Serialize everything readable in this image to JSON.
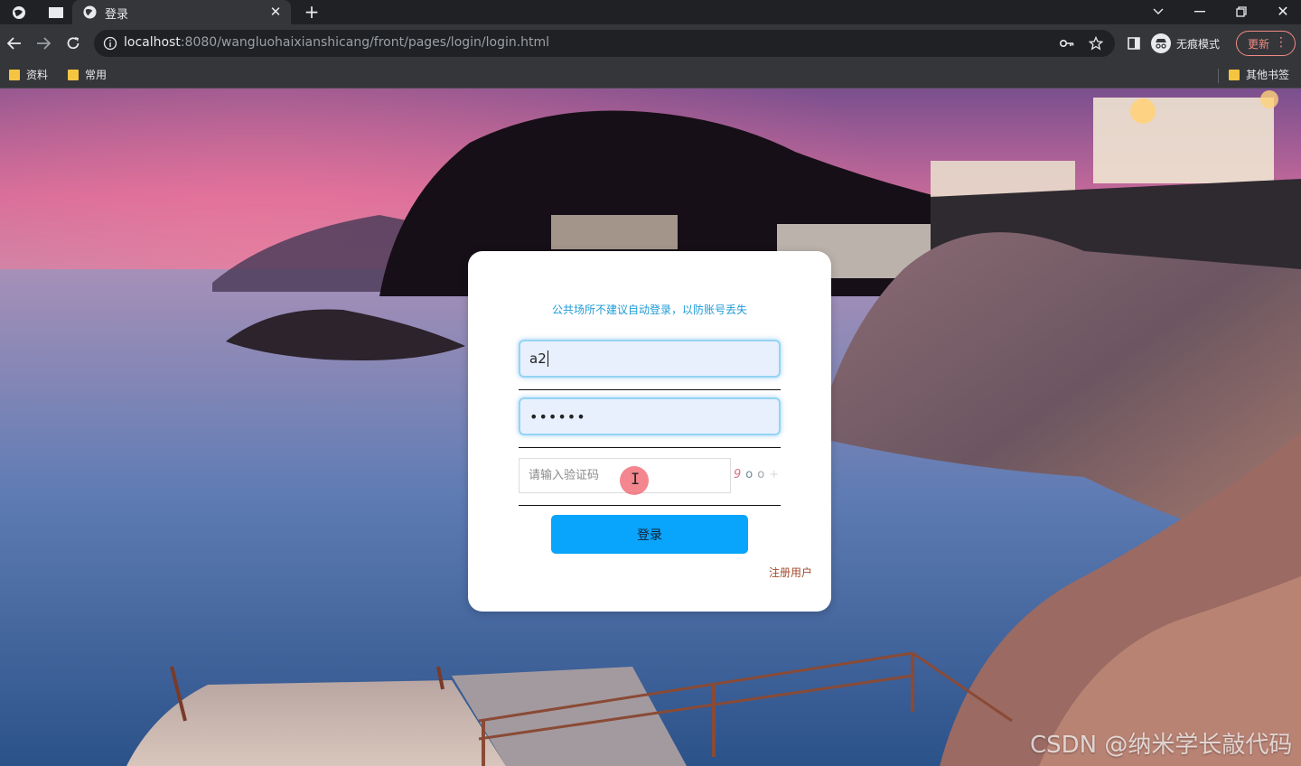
{
  "browser": {
    "tab_title": "登录",
    "url_host": "localhost",
    "url_rest": ":8080/wangluohaixianshicang/front/pages/login/login.html",
    "incognito_label": "无痕模式",
    "update_label": "更新",
    "bookmarks": [
      "资料",
      "常用"
    ],
    "other_bookmarks": "其他书签"
  },
  "login": {
    "hint": "公共场所不建议自动登录，以防账号丢失",
    "username_value": "a2",
    "password_value": "••••••",
    "captcha_placeholder": "请输入验证码",
    "captcha_chars": [
      "9",
      "o",
      "o",
      "+"
    ],
    "login_button": "登录",
    "register_link": "注册用户"
  },
  "watermark": "CSDN @纳米学长敲代码",
  "colors": {
    "hint": "#1e9bd7",
    "button": "#09a4fb",
    "register": "#a24b2b"
  }
}
